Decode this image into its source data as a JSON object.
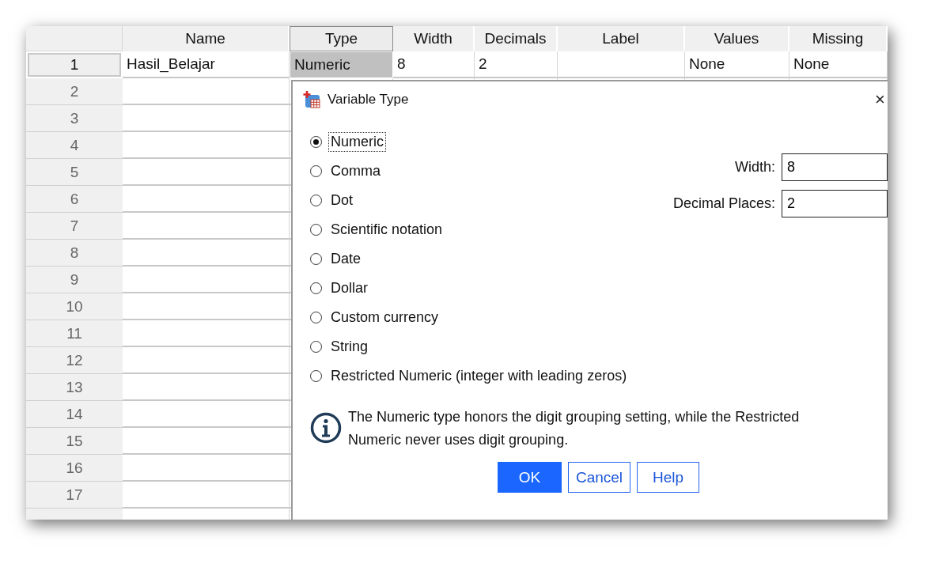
{
  "grid": {
    "columns": [
      {
        "label": "Name",
        "selected": false
      },
      {
        "label": "Type",
        "selected": true
      },
      {
        "label": "Width",
        "selected": false
      },
      {
        "label": "Decimals",
        "selected": false
      },
      {
        "label": "Label",
        "selected": false
      },
      {
        "label": "Values",
        "selected": false
      },
      {
        "label": "Missing",
        "selected": false
      }
    ],
    "rows": [
      {
        "number": "1",
        "selected": true,
        "cells": [
          "Hasil_Belajar",
          "Numeric",
          "8",
          "2",
          null,
          "None",
          "None"
        ]
      },
      {
        "number": "2",
        "selected": false
      },
      {
        "number": "3",
        "selected": false
      },
      {
        "number": "4",
        "selected": false
      },
      {
        "number": "5",
        "selected": false
      },
      {
        "number": "6",
        "selected": false
      },
      {
        "number": "7",
        "selected": false
      },
      {
        "number": "8",
        "selected": false
      },
      {
        "number": "9",
        "selected": false
      },
      {
        "number": "10",
        "selected": false
      },
      {
        "number": "11",
        "selected": false
      },
      {
        "number": "12",
        "selected": false
      },
      {
        "number": "13",
        "selected": false
      },
      {
        "number": "14",
        "selected": false
      },
      {
        "number": "15",
        "selected": false
      },
      {
        "number": "16",
        "selected": false
      },
      {
        "number": "17",
        "selected": false
      }
    ]
  },
  "dialog": {
    "title": "Variable Type",
    "close": "×",
    "options": [
      {
        "label": "Numeric",
        "selected": true
      },
      {
        "label": "Comma",
        "selected": false
      },
      {
        "label": "Dot",
        "selected": false
      },
      {
        "label": "Scientific notation",
        "selected": false
      },
      {
        "label": "Date",
        "selected": false
      },
      {
        "label": "Dollar",
        "selected": false
      },
      {
        "label": "Custom currency",
        "selected": false
      },
      {
        "label": "String",
        "selected": false
      },
      {
        "label": "Restricted Numeric (integer with leading zeros)",
        "selected": false
      }
    ],
    "fields": [
      {
        "label": "Width:",
        "value": "8"
      },
      {
        "label": "Decimal Places:",
        "value": "2"
      }
    ],
    "info": "The Numeric type honors the digit grouping setting, while the Restricted Numeric never uses digit grouping.",
    "buttons": [
      {
        "label": "OK",
        "kind": "primary"
      },
      {
        "label": "Cancel",
        "kind": "secondary"
      },
      {
        "label": "Help",
        "kind": "secondary"
      }
    ]
  }
}
